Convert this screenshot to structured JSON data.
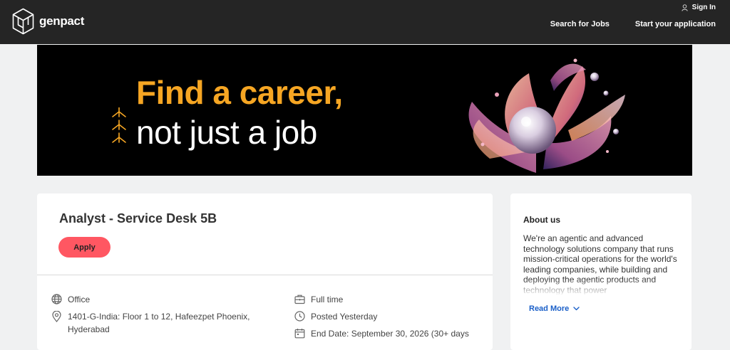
{
  "header": {
    "brand": "genpact",
    "sign_in": "Sign In",
    "nav": [
      "Search for Jobs",
      "Start your application"
    ]
  },
  "banner": {
    "line1": "Find a career,",
    "line2": "not just a job",
    "accent_color": "#f6a623"
  },
  "job": {
    "title": "Analyst - Service Desk 5B",
    "apply_label": "Apply",
    "workplace": "Office",
    "location_line1": "1401-G-India: Floor 1 to 12, Hafeezpet Phoenix,",
    "location_line2": "Hyderabad",
    "employment": "Full time",
    "posted": "Posted Yesterday",
    "end_date": "End Date: September 30, 2026 (30+ days"
  },
  "about": {
    "title": "About us",
    "text": "We're an agentic and advanced technology solutions company that runs mission-critical operations for the world's leading companies, while building and deploying the agentic products and technology that power",
    "read_more": "Read More"
  },
  "icons": {
    "logo": "genpact-cube-logo",
    "user": "user-icon",
    "globe": "globe-icon",
    "location": "location-pin-icon",
    "briefcase": "briefcase-icon",
    "clock": "clock-icon",
    "calendar": "calendar-icon",
    "chevron": "chevron-down-icon"
  },
  "colors": {
    "header_bg": "#252525",
    "apply_button": "#ff5762",
    "link": "#1a5fc8",
    "page_bg": "#f0f1f2"
  }
}
